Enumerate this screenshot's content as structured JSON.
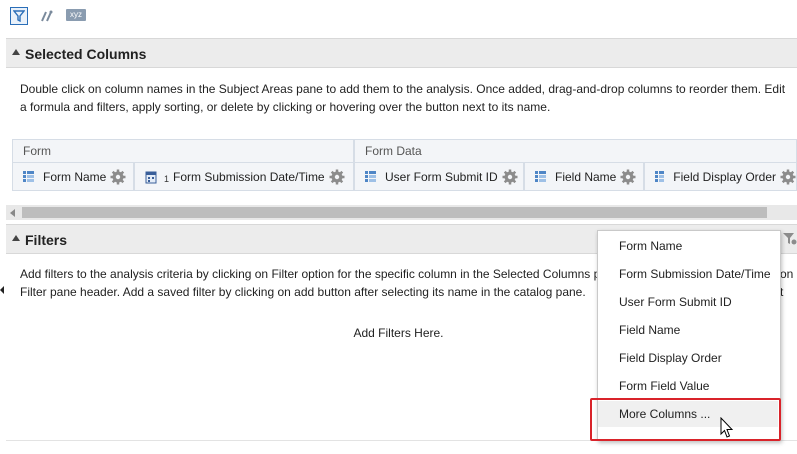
{
  "toolbar": {
    "filter_icon": "filter-icon",
    "sort_icon": "sort-icon",
    "xyz_label": "xyz"
  },
  "selected_columns": {
    "title": "Selected Columns",
    "description": "Double click on column names in the Subject Areas pane to add them to the analysis. Once added, drag-and-drop columns to reorder them. Edit a formula and filters, apply sorting, or delete by clicking or hovering over the button next to its name.",
    "groups": [
      {
        "label": "Form"
      },
      {
        "label": "Form Data"
      }
    ],
    "columns": [
      {
        "label": "Form Name",
        "icon": "column-icon",
        "sub": ""
      },
      {
        "label": "Form Submission Date/Time",
        "icon": "date-column-icon",
        "sub": "1"
      },
      {
        "label": "User Form Submit ID",
        "icon": "column-icon",
        "sub": ""
      },
      {
        "label": "Field Name",
        "icon": "column-icon",
        "sub": ""
      },
      {
        "label": "Field Display Order",
        "icon": "column-icon",
        "sub": ""
      }
    ]
  },
  "filters": {
    "title": "Filters",
    "description": "Add filters to the analysis criteria by clicking on Filter option for the specific column in the Selected Columns p                                                                                          on t Filter pane header. Add a saved filter by clicking on add button after selecting its name in the catalog pane.",
    "description_line1": "Add filters to the analysis criteria by clicking on Filter option for the specific column in the Selected Columns p",
    "description_line1_tail": "on t",
    "description_line2": "Filter pane header. Add a saved filter by clicking on add button after selecting its name in the catalog pane.",
    "placeholder": "Add Filters Here."
  },
  "dropdown_menu": {
    "items": [
      {
        "label": "Form Name"
      },
      {
        "label": "Form Submission Date/Time"
      },
      {
        "label": "User Form Submit ID"
      },
      {
        "label": "Field Name"
      },
      {
        "label": "Field Display Order"
      },
      {
        "label": "Form Field Value"
      }
    ],
    "more_label": "More Columns ..."
  },
  "colors": {
    "highlight_border": "#d9232a",
    "accent_blue": "#2a6eb8"
  }
}
